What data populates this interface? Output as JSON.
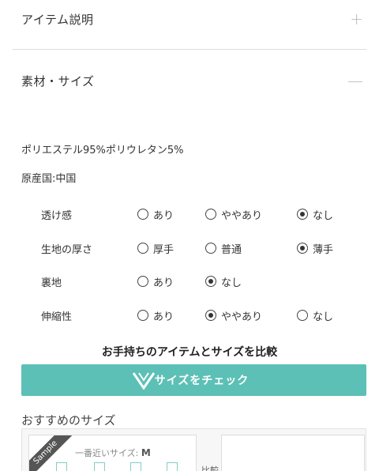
{
  "accordion": {
    "item_description": {
      "title": "アイテム説明",
      "icon": "+"
    },
    "material_size": {
      "title": "素材・サイズ",
      "icon": "—"
    }
  },
  "material": "ポリエステル95%ポリウレタン5%",
  "origin": "原産国:中国",
  "attributes": [
    {
      "label": "透け感",
      "options": [
        "あり",
        "ややあり",
        "なし"
      ],
      "selected": 2
    },
    {
      "label": "生地の厚さ",
      "options": [
        "厚手",
        "普通",
        "薄手"
      ],
      "selected": 2
    },
    {
      "label": "裏地",
      "options": [
        "あり",
        "なし"
      ],
      "selected": 1
    },
    {
      "label": "伸縮性",
      "options": [
        "あり",
        "ややあり",
        "なし"
      ],
      "selected": 1
    }
  ],
  "compare_title": "お手持ちのアイテムとサイズを比較",
  "check_button": "サイズをチェック",
  "recommended": {
    "title": "おすすめのサイズ",
    "ribbon": "Sample",
    "nearest_label": "一番近いサイズ:",
    "nearest_size": "M",
    "compare": "比較"
  },
  "colors": {
    "accent": "#5cc0b6"
  }
}
